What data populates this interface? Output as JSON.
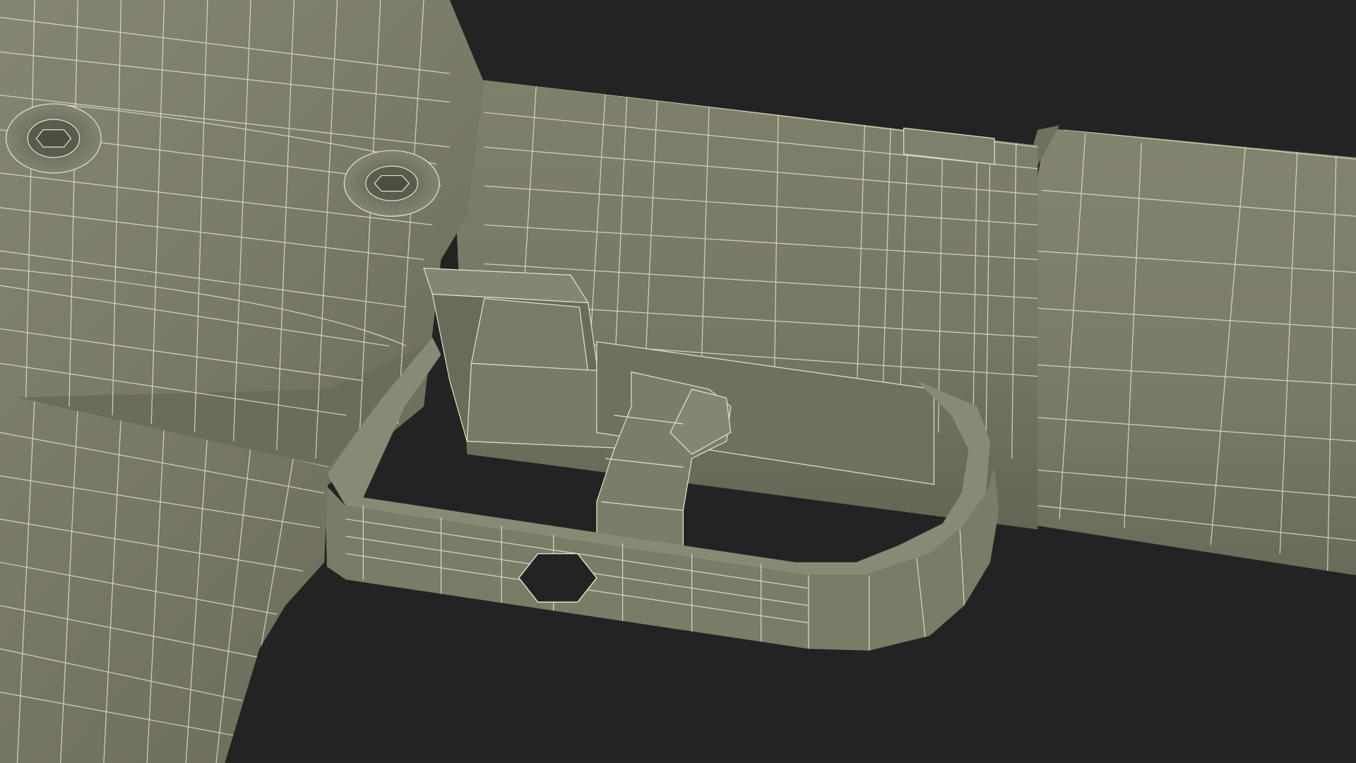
{
  "render": {
    "subject": "wireframe-render",
    "colors": {
      "background": "#232323",
      "surface": "#7a7b68",
      "surface_light": "#878875",
      "surface_dark": "#5f604f",
      "surface_shadow": "#4d4e40",
      "wire": "#e4e2cc"
    },
    "parts": [
      "lower-receiver",
      "buffer-tube",
      "stock",
      "trigger-guard",
      "trigger",
      "hammer-housing",
      "grip",
      "pivot-screws"
    ]
  }
}
